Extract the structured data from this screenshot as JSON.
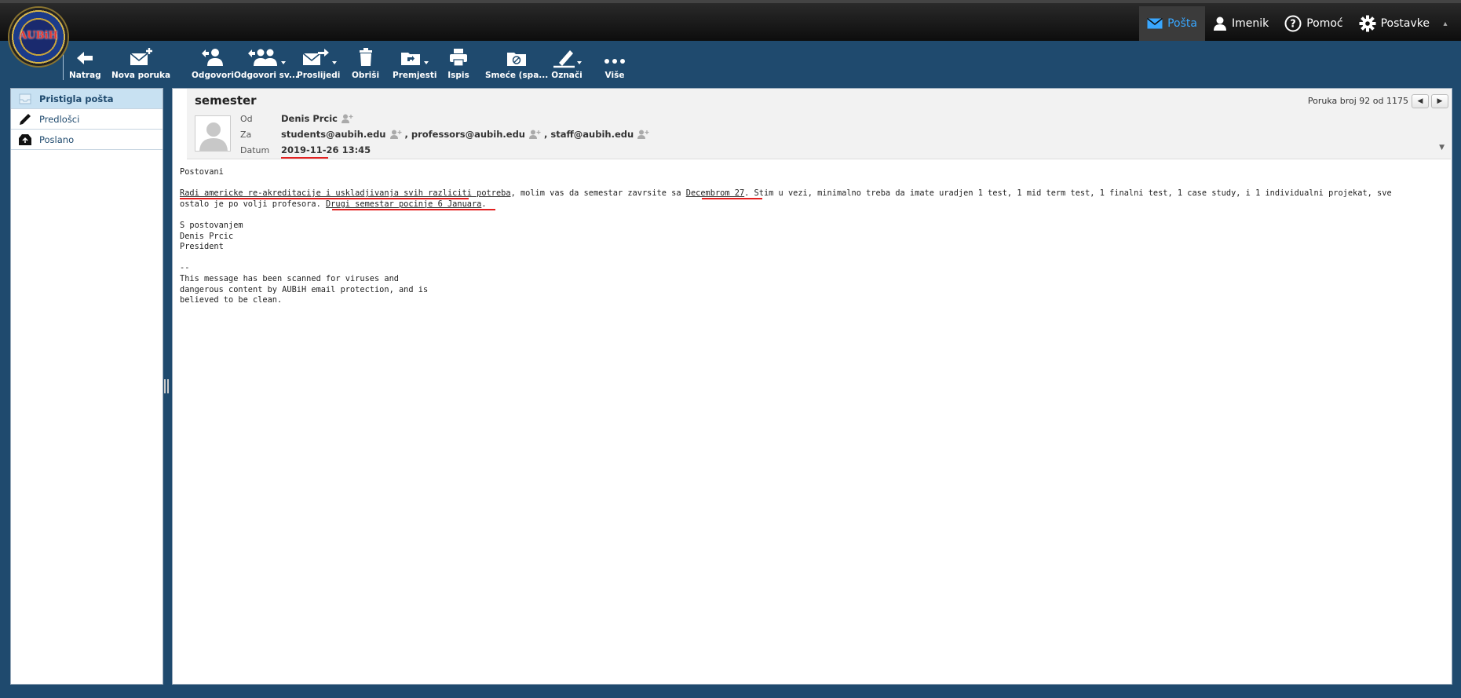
{
  "logo": {
    "text": "AUBiH"
  },
  "topnav": [
    {
      "label": "Pošta",
      "icon": "mail-icon",
      "active": true
    },
    {
      "label": "Imenik",
      "icon": "person-icon"
    },
    {
      "label": "Pomoć",
      "icon": "help-icon"
    },
    {
      "label": "Postavke",
      "icon": "gear-icon"
    }
  ],
  "toolbar": {
    "back": "Natrag",
    "new_message": "Nova poruka",
    "reply": "Odgovori",
    "reply_all": "Odgovori sv...",
    "forward": "Proslijedi",
    "delete": "Obriši",
    "move": "Premjesti",
    "print": "Ispis",
    "spam": "Smeće (spa...",
    "mark": "Označi",
    "more": "Više"
  },
  "sidebar": {
    "items": [
      {
        "label": "Pristigla pošta",
        "icon": "inbox-icon",
        "active": true
      },
      {
        "label": "Predlošci",
        "icon": "pencil-icon"
      },
      {
        "label": "Poslano",
        "icon": "sent-icon"
      }
    ]
  },
  "message": {
    "subject": "semester",
    "from_label": "Od",
    "from": "Denis Prcic",
    "to_label": "Za",
    "to": [
      "students@aubih.edu",
      "professors@aubih.edu",
      "staff@aubih.edu"
    ],
    "date_label": "Datum",
    "date": "2019-11-26 13:45",
    "count": "Poruka broj 92 od 1175",
    "body": {
      "greeting": "Postovani",
      "p1_a": "Radi americke re-akreditacije i uskladjivanja svih razliciti potreba",
      "p1_b": ", molim vas da semestar zavrsite sa ",
      "p1_c": "Decembrom 27",
      "p1_d": ". Stim u vezi, minimalno treba da imate uradjen 1 test, 1 mid term test, 1 finalni test, 1 case study, i 1 individualni projekat, sve\nostalo je po volji profesora. ",
      "p1_e": "Drugi semestar pocinje 6 Januara",
      "p1_f": ".",
      "signoff": "S postovanjem\nDenis Prcic\nPresident",
      "footer": "--\nThis message has been scanned for viruses and\ndangerous content by AUBiH email protection, and is\nbelieved to be clean."
    }
  },
  "colors": {
    "accent": "#1f4a6e",
    "active_link": "#39a7ff",
    "highlight": "#e32020"
  }
}
